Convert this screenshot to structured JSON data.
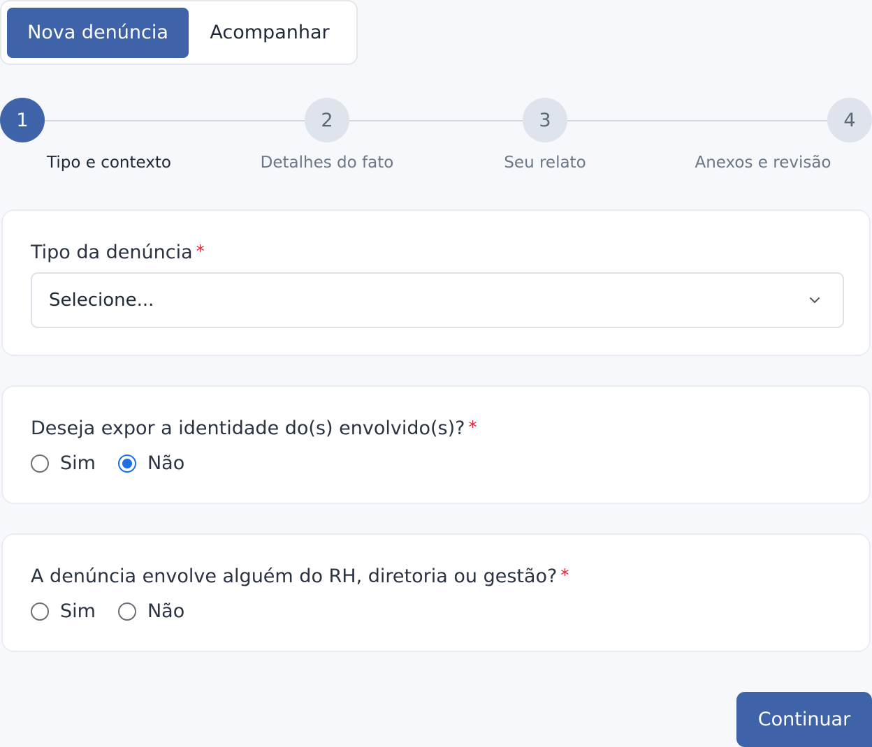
{
  "tabs": [
    {
      "label": "Nova denúncia",
      "active": true
    },
    {
      "label": "Acompanhar",
      "active": false
    }
  ],
  "steps": [
    {
      "number": "1",
      "label": "Tipo e contexto",
      "active": true
    },
    {
      "number": "2",
      "label": "Detalhes do fato",
      "active": false
    },
    {
      "number": "3",
      "label": "Seu relato",
      "active": false
    },
    {
      "number": "4",
      "label": "Anexos e revisão",
      "active": false
    }
  ],
  "form": {
    "type": {
      "label": "Tipo da denúncia",
      "required_mark": "*",
      "selected_value": "Selecione..."
    },
    "expose_identity": {
      "question": "Deseja expor a identidade do(s) envolvido(s)?",
      "required_mark": "*",
      "options": [
        {
          "label": "Sim",
          "checked": false
        },
        {
          "label": "Não",
          "checked": true
        }
      ]
    },
    "involves_management": {
      "question": "A denúncia envolve alguém do RH, diretoria ou gestão?",
      "required_mark": "*",
      "options": [
        {
          "label": "Sim",
          "checked": false
        },
        {
          "label": "Não",
          "checked": false
        }
      ]
    }
  },
  "continue_label": "Continuar",
  "colors": {
    "primary": "#3f63a8",
    "radio_checked": "#1f6fe5",
    "required": "#e0283d",
    "background": "#f6f8fc"
  },
  "icons": {
    "select_arrow": "chevron-down-icon"
  }
}
